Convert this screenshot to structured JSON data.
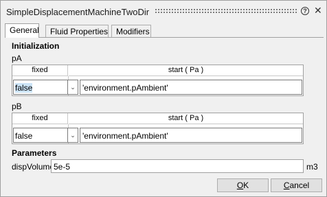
{
  "window": {
    "title": "SimpleDisplacementMachineTwoDir",
    "help_glyph": "?",
    "close_glyph": "✕"
  },
  "tabs": [
    {
      "label": "General",
      "active": true
    },
    {
      "label": "Fluid Properties",
      "active": false
    },
    {
      "label": "Modifiers",
      "active": false
    }
  ],
  "initialization": {
    "section_title": "Initialization",
    "pA": {
      "label": "pA",
      "header_fixed": "fixed",
      "header_start": "start ( Pa )",
      "fixed_value": "false",
      "start_value": "'environment.pAmbient'"
    },
    "pB": {
      "label": "pB",
      "header_fixed": "fixed",
      "header_start": "start ( Pa )",
      "fixed_value": "false",
      "start_value": "'environment.pAmbient'"
    }
  },
  "parameters": {
    "section_title": "Parameters",
    "dispVolume": {
      "label": "dispVolume",
      "value": "5e-5",
      "unit": "m3"
    }
  },
  "buttons": {
    "ok": {
      "prefix": "",
      "accel": "O",
      "rest": "K"
    },
    "cancel": {
      "prefix": "",
      "accel": "C",
      "rest": "ancel"
    }
  },
  "icons": {
    "dropdown": "chevron-down-icon",
    "help": "help-icon",
    "close": "close-icon"
  }
}
